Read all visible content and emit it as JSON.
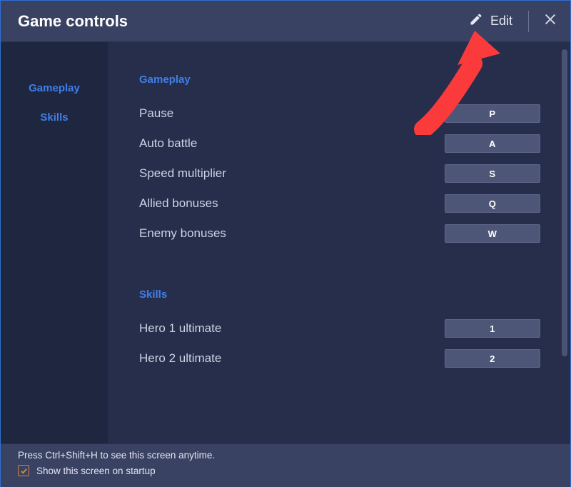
{
  "header": {
    "title": "Game controls",
    "edit_label": "Edit"
  },
  "sidebar": {
    "items": [
      {
        "label": "Gameplay"
      },
      {
        "label": "Skills"
      }
    ]
  },
  "sections": [
    {
      "title": "Gameplay",
      "rows": [
        {
          "label": "Pause",
          "key": "P"
        },
        {
          "label": "Auto battle",
          "key": "A"
        },
        {
          "label": "Speed multiplier",
          "key": "S"
        },
        {
          "label": "Allied bonuses",
          "key": "Q"
        },
        {
          "label": "Enemy bonuses",
          "key": "W"
        }
      ]
    },
    {
      "title": "Skills",
      "rows": [
        {
          "label": "Hero 1 ultimate",
          "key": "1"
        },
        {
          "label": "Hero 2 ultimate",
          "key": "2"
        }
      ]
    }
  ],
  "footer": {
    "hint": "Press Ctrl+Shift+H to see this screen anytime.",
    "checkbox_label": "Show this screen on startup",
    "checkbox_checked": true
  }
}
